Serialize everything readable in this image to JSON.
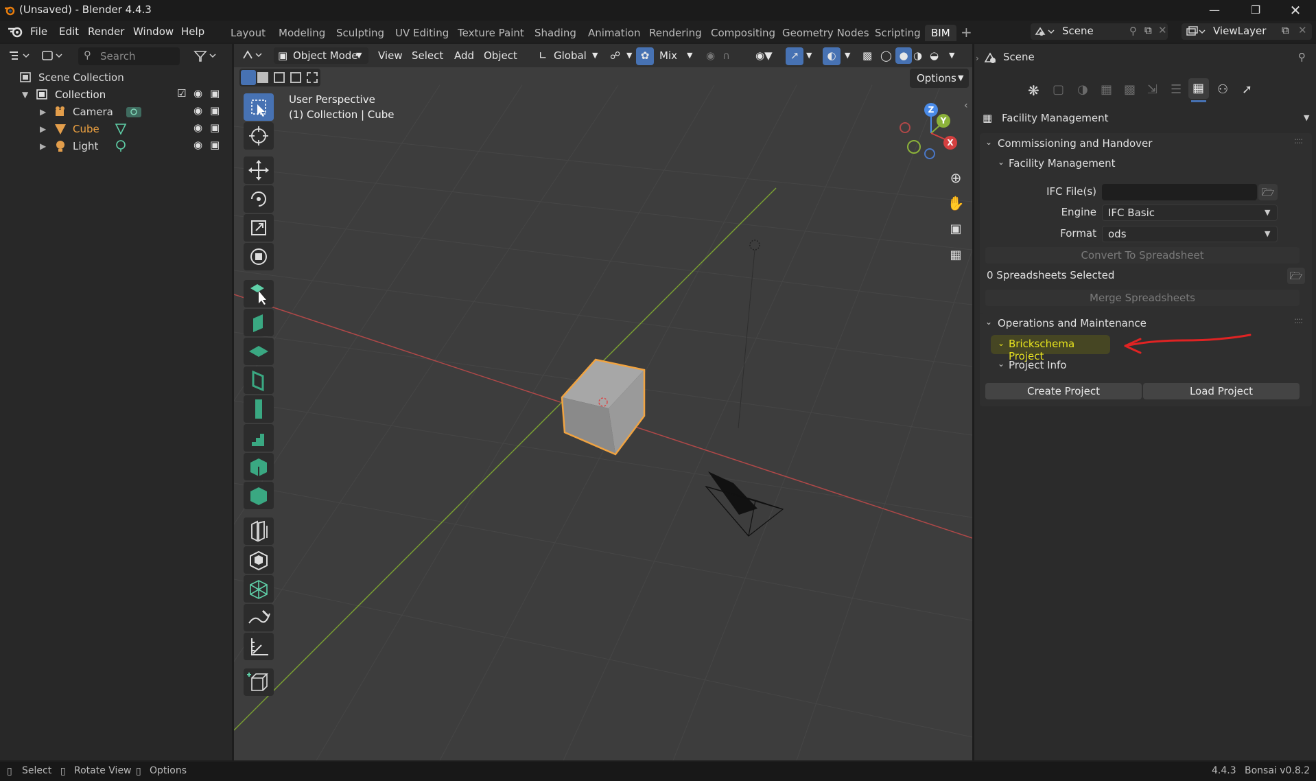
{
  "window": {
    "title": "(Unsaved) - Blender 4.4.3"
  },
  "menu": [
    "File",
    "Edit",
    "Render",
    "Window",
    "Help"
  ],
  "workspaces": [
    "Layout",
    "Modeling",
    "Sculpting",
    "UV Editing",
    "Texture Paint",
    "Shading",
    "Animation",
    "Rendering",
    "Compositing",
    "Geometry Nodes",
    "Scripting",
    "BIM"
  ],
  "active_workspace": "BIM",
  "scene_field": "Scene",
  "viewlayer_field": "ViewLayer",
  "outliner": {
    "search_placeholder": "Search",
    "root": "Scene Collection",
    "collection": "Collection",
    "items": [
      "Camera",
      "Cube",
      "Light"
    ],
    "selected": "Cube"
  },
  "viewport": {
    "mode": "Object Mode",
    "menus": [
      "View",
      "Select",
      "Add",
      "Object"
    ],
    "transform_orientation": "Global",
    "snap_mode": "Mix",
    "options_label": "Options",
    "overlay_line1": "User Perspective",
    "overlay_line2": "(1) Collection | Cube",
    "gizmo": {
      "z": "Z",
      "y": "Y",
      "x": "X"
    }
  },
  "properties": {
    "context": "Scene",
    "panel_selector": "Facility Management",
    "commissioning": {
      "title": "Commissioning and Handover",
      "sub": "Facility Management",
      "ifc_label": "IFC File(s)",
      "ifc_value": "",
      "engine_label": "Engine",
      "engine_value": "IFC Basic",
      "format_label": "Format",
      "format_value": "ods",
      "convert_btn": "Convert To Spreadsheet",
      "selected_text": "0 Spreadsheets Selected",
      "merge_btn": "Merge Spreadsheets"
    },
    "operations": {
      "title": "Operations and Maintenance",
      "brick": "Brickschema Project",
      "project_info": "Project Info",
      "create_btn": "Create Project",
      "load_btn": "Load Project"
    }
  },
  "status": {
    "select": "Select",
    "rotate": "Rotate View",
    "options": "Options",
    "version": "4.4.3",
    "addon": "Bonsai v0.8.2"
  },
  "colors": {
    "accent": "#4772b3",
    "selected_object": "#f0a341",
    "highlight": "#e8e41e",
    "annotation_arrow": "#e02323",
    "axis_x": "#d44040",
    "axis_y": "#8cb23a"
  }
}
